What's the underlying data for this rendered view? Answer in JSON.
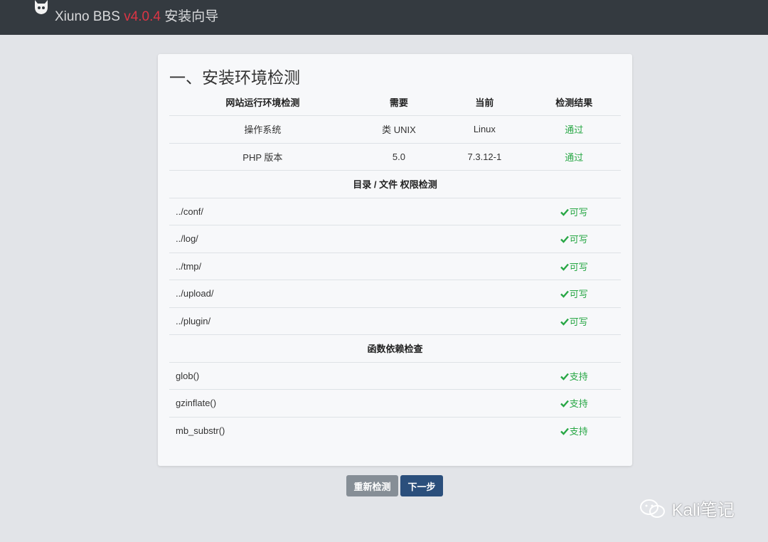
{
  "header": {
    "brand_name": "Xiuno BBS",
    "version": "v4.0.4",
    "wizard_label": "安装向导",
    "version_color": "#dc3545"
  },
  "main": {
    "title": "一、安装环境检测",
    "env_table": {
      "headers": [
        "网站运行环境检测",
        "需要",
        "当前",
        "检测结果"
      ],
      "rows": [
        {
          "item": "操作系统",
          "required": "类 UNIX",
          "current": "Linux",
          "result": "通过"
        },
        {
          "item": "PHP 版本",
          "required": "5.0",
          "current": "7.3.12-1",
          "result": "通过"
        }
      ]
    },
    "dir_section": {
      "heading": "目录 / 文件 权限检测",
      "rows": [
        {
          "path": "../conf/",
          "status": "可写"
        },
        {
          "path": "../log/",
          "status": "可写"
        },
        {
          "path": "../tmp/",
          "status": "可写"
        },
        {
          "path": "../upload/",
          "status": "可写"
        },
        {
          "path": "../plugin/",
          "status": "可写"
        }
      ]
    },
    "func_section": {
      "heading": "函数依赖检查",
      "rows": [
        {
          "name": "glob()",
          "status": "支持"
        },
        {
          "name": "gzinflate()",
          "status": "支持"
        },
        {
          "name": "mb_substr()",
          "status": "支持"
        }
      ]
    },
    "success_color": "#28a745"
  },
  "actions": {
    "recheck_label": "重新检测",
    "next_label": "下一步"
  },
  "watermark": {
    "text": "Kali笔记",
    "icon": "wechat-icon"
  }
}
